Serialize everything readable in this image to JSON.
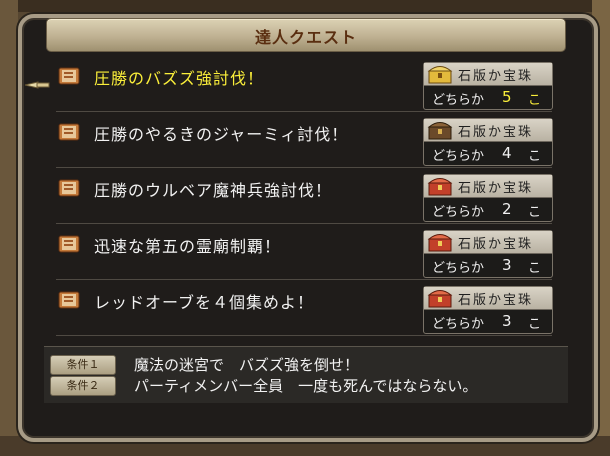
{
  "window": {
    "title": "達人クエスト"
  },
  "quests": [
    {
      "name": "圧勝のバズズ強討伐！",
      "reward_name": "石版か宝珠",
      "reward_either": "どちらか",
      "reward_count": "5",
      "reward_unit": "こ",
      "selected": true,
      "chest": "gold-chest-icon"
    },
    {
      "name": "圧勝のやるきのジャーミィ討伐！",
      "reward_name": "石版か宝珠",
      "reward_either": "どちらか",
      "reward_count": "4",
      "reward_unit": "こ",
      "selected": false,
      "chest": "bronze-chest-icon"
    },
    {
      "name": "圧勝のウルベア魔神兵強討伐！",
      "reward_name": "石版か宝珠",
      "reward_either": "どちらか",
      "reward_count": "2",
      "reward_unit": "こ",
      "selected": false,
      "chest": "red-chest-icon"
    },
    {
      "name": "迅速な第五の霊廟制覇！",
      "reward_name": "石版か宝珠",
      "reward_either": "どちらか",
      "reward_count": "3",
      "reward_unit": "こ",
      "selected": false,
      "chest": "red-chest-icon"
    },
    {
      "name": "レッドオーブを４個集めよ！",
      "reward_name": "石版か宝珠",
      "reward_either": "どちらか",
      "reward_count": "3",
      "reward_unit": "こ",
      "selected": false,
      "chest": "red-chest-icon"
    }
  ],
  "conditions": [
    {
      "badge": "条件１",
      "text": "魔法の迷宮で　バズズ強を倒せ！"
    },
    {
      "badge": "条件２",
      "text": "パーティメンバー全員　一度も死んではならない。"
    }
  ],
  "colors": {
    "selected_text": "#fbef3a",
    "panel_bg": "#1c1a18",
    "frame": "#a79b86"
  }
}
